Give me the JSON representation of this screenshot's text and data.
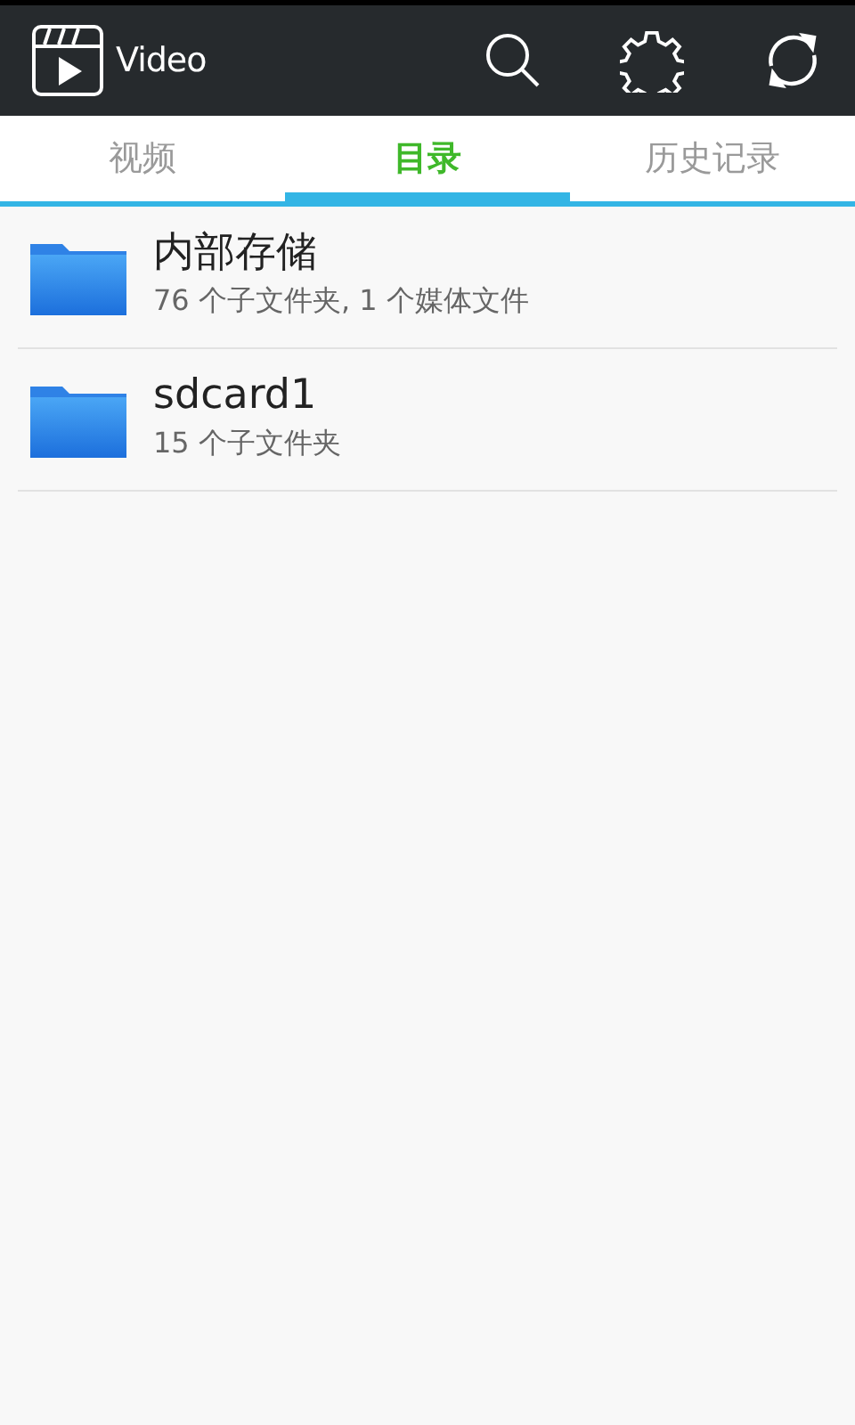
{
  "app_bar": {
    "title": "Video"
  },
  "tabs": [
    {
      "label": "视频",
      "selected": false
    },
    {
      "label": "目录",
      "selected": true
    },
    {
      "label": "历史记录",
      "selected": false
    }
  ],
  "folders": [
    {
      "name": "内部存储",
      "details": "76 个子文件夹, 1 个媒体文件"
    },
    {
      "name": "sdcard1",
      "details": "15 个子文件夹"
    }
  ]
}
